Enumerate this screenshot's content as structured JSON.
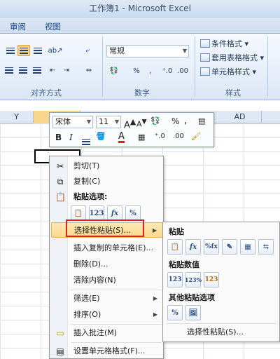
{
  "window": {
    "title": "工作簿1 - Microsoft Excel"
  },
  "tabs": [
    "审阅",
    "视图"
  ],
  "ribbon": {
    "groups": [
      "对齐方式",
      "数字",
      "样式"
    ],
    "number_format": "常规",
    "number_buttons": {
      "percent": "%",
      "comma": ",",
      "inc_decimal": "⁺.0",
      "dec_decimal": ".00"
    },
    "style_buttons": [
      "条件格式",
      "套用表格格式",
      "单元格样式"
    ]
  },
  "columns": [
    "Y",
    "AD"
  ],
  "mini_toolbar": {
    "font": "宋体",
    "size": "11",
    "grow": "A",
    "shrink": "A",
    "percent": "%",
    "comma": ",",
    "bold": "B",
    "italic": "I",
    "font_color": "A"
  },
  "context_menu": {
    "items": [
      {
        "label": "剪切(T)",
        "icon": "scissors-icon"
      },
      {
        "label": "复制(C)",
        "icon": "copy-icon"
      },
      {
        "label": "粘贴选项:",
        "icon": "paste-icon"
      },
      {
        "label": "选择性粘贴(S)...",
        "icon": ""
      },
      {
        "label": "插入复制的单元格(E)...",
        "icon": ""
      },
      {
        "label": "删除(D)...",
        "icon": ""
      },
      {
        "label": "清除内容(N)",
        "icon": ""
      },
      {
        "label": "筛选(E)",
        "icon": ""
      },
      {
        "label": "排序(O)",
        "icon": ""
      },
      {
        "label": "插入批注(M)",
        "icon": "comment-icon"
      },
      {
        "label": "设置单元格格式(F)...",
        "icon": "format-cells-icon"
      }
    ],
    "paste_options": [
      "📋",
      "123",
      "fx",
      "%"
    ]
  },
  "submenu": {
    "sections": [
      "粘贴",
      "粘贴数值",
      "其他粘贴选项"
    ],
    "paste_icons": [
      "📋",
      "fx",
      "%fx",
      "✎",
      "▦",
      "⇆"
    ],
    "value_icons": [
      "123",
      "123%",
      "123"
    ],
    "other_icons": [
      "%",
      "🖼"
    ],
    "footer": "选择性粘贴(S)..."
  },
  "colors": {
    "highlight": "#fbd88c",
    "callout": "#d6261f",
    "ribbon": "#e6eef9"
  }
}
